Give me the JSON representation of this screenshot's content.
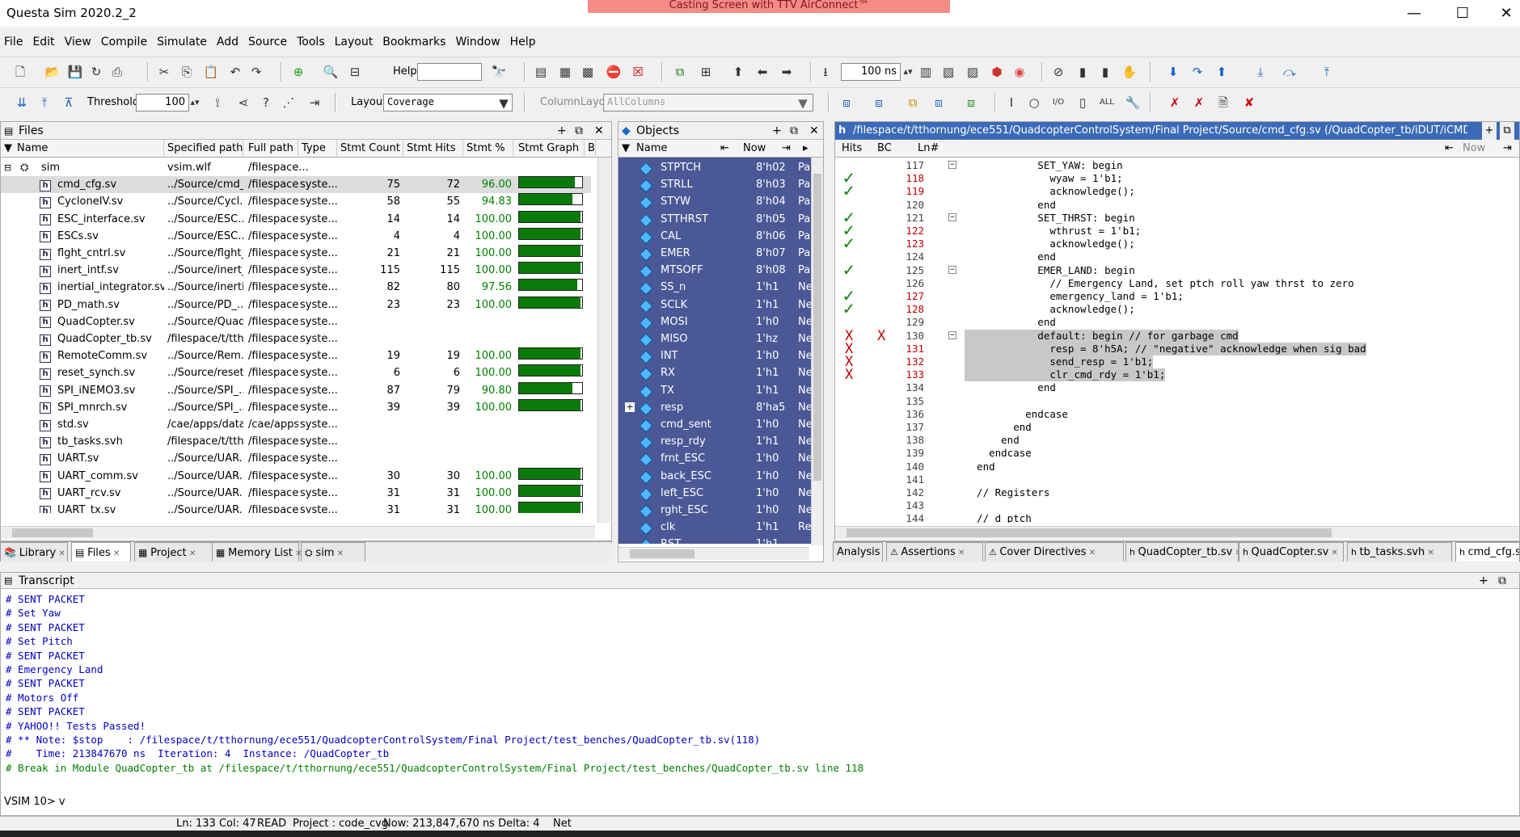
{
  "window": {
    "title": "Questa Sim 2020.2_2",
    "banner": "Casting Screen with TTV AirConnect™"
  },
  "menu": [
    "File",
    "Edit",
    "View",
    "Compile",
    "Simulate",
    "Add",
    "Source",
    "Tools",
    "Layout",
    "Bookmarks",
    "Window",
    "Help"
  ],
  "toolbar": {
    "help_label": "Help",
    "time_value": "100 ns",
    "threshold_label": "Threshold",
    "threshold_value": "100",
    "layout_label": "Layout",
    "layout_value": "Coverage",
    "columnlayout_label": "ColumnLayout",
    "columnlayout_value": "AllColumns"
  },
  "files_pane": {
    "title": "Files",
    "columns": [
      "Name",
      "Specified path",
      "Full path",
      "Type",
      "Stmt Count",
      "Stmt Hits",
      "Stmt %",
      "Stmt Graph",
      "B"
    ],
    "root": {
      "name": "sim",
      "spec": "vsim.wlf",
      "full": "/filespace..."
    },
    "rows": [
      {
        "name": "cmd_cfg.sv",
        "spec": "../Source/cmd_...",
        "full": "/filespace...",
        "type": "syste...",
        "count": "75",
        "hits": "72",
        "pct": "96.00",
        "fill": 0.96
      },
      {
        "name": "CycloneIV.sv",
        "spec": "../Source/Cycl...",
        "full": "/filespace...",
        "type": "syste...",
        "count": "58",
        "hits": "55",
        "pct": "94.83",
        "fill": 0.9483
      },
      {
        "name": "ESC_interface.sv",
        "spec": "../Source/ESC...",
        "full": "/filespace...",
        "type": "syste...",
        "count": "14",
        "hits": "14",
        "pct": "100.00",
        "fill": 1
      },
      {
        "name": "ESCs.sv",
        "spec": "../Source/ESC...",
        "full": "/filespace...",
        "type": "syste...",
        "count": "4",
        "hits": "4",
        "pct": "100.00",
        "fill": 1
      },
      {
        "name": "flght_cntrl.sv",
        "spec": "../Source/flght_...",
        "full": "/filespace...",
        "type": "syste...",
        "count": "21",
        "hits": "21",
        "pct": "100.00",
        "fill": 1
      },
      {
        "name": "inert_intf.sv",
        "spec": "../Source/inert_...",
        "full": "/filespace...",
        "type": "syste...",
        "count": "115",
        "hits": "115",
        "pct": "100.00",
        "fill": 1
      },
      {
        "name": "inertial_integrator.sv",
        "spec": "../Source/inerti...",
        "full": "/filespace...",
        "type": "syste...",
        "count": "82",
        "hits": "80",
        "pct": "97.56",
        "fill": 0.9756
      },
      {
        "name": "PD_math.sv",
        "spec": "../Source/PD_...",
        "full": "/filespace...",
        "type": "syste...",
        "count": "23",
        "hits": "23",
        "pct": "100.00",
        "fill": 1
      },
      {
        "name": "QuadCopter.sv",
        "spec": "../Source/Quad...",
        "full": "/filespace...",
        "type": "syste...",
        "count": "",
        "hits": "",
        "pct": "",
        "fill": null
      },
      {
        "name": "QuadCopter_tb.sv",
        "spec": "/filespace/t/ttho...",
        "full": "/filespace...",
        "type": "syste...",
        "count": "",
        "hits": "",
        "pct": "",
        "fill": null
      },
      {
        "name": "RemoteComm.sv",
        "spec": "../Source/Rem...",
        "full": "/filespace...",
        "type": "syste...",
        "count": "19",
        "hits": "19",
        "pct": "100.00",
        "fill": 1
      },
      {
        "name": "reset_synch.sv",
        "spec": "../Source/reset...",
        "full": "/filespace...",
        "type": "syste...",
        "count": "6",
        "hits": "6",
        "pct": "100.00",
        "fill": 1
      },
      {
        "name": "SPI_iNEMO3.sv",
        "spec": "../Source/SPI_...",
        "full": "/filespace...",
        "type": "syste...",
        "count": "87",
        "hits": "79",
        "pct": "90.80",
        "fill": 0.908
      },
      {
        "name": "SPI_mnrch.sv",
        "spec": "../Source/SPI_...",
        "full": "/filespace...",
        "type": "syste...",
        "count": "39",
        "hits": "39",
        "pct": "100.00",
        "fill": 1
      },
      {
        "name": "std.sv",
        "spec": "/cae/apps/data/...",
        "full": "/cae/apps...",
        "type": "syste...",
        "count": "",
        "hits": "",
        "pct": "",
        "fill": null
      },
      {
        "name": "tb_tasks.svh",
        "spec": "/filespace/t/ttho...",
        "full": "/filespace...",
        "type": "syste...",
        "count": "",
        "hits": "",
        "pct": "",
        "fill": null
      },
      {
        "name": "UART.sv",
        "spec": "../Source/UAR...",
        "full": "/filespace...",
        "type": "syste...",
        "count": "",
        "hits": "",
        "pct": "",
        "fill": null
      },
      {
        "name": "UART_comm.sv",
        "spec": "../Source/UAR...",
        "full": "/filespace...",
        "type": "syste...",
        "count": "30",
        "hits": "30",
        "pct": "100.00",
        "fill": 1
      },
      {
        "name": "UART_rcv.sv",
        "spec": "../Source/UAR...",
        "full": "/filespace...",
        "type": "syste...",
        "count": "31",
        "hits": "31",
        "pct": "100.00",
        "fill": 1
      },
      {
        "name": "UART_tx.sv",
        "spec": "../Source/UAR...",
        "full": "/filespace...",
        "type": "syste...",
        "count": "31",
        "hits": "31",
        "pct": "100.00",
        "fill": 1
      }
    ]
  },
  "left_tabs": [
    "Library",
    "Files",
    "Project",
    "Memory List",
    "sim"
  ],
  "objects_pane": {
    "title": "Objects",
    "name_col": "Name",
    "now_label": "Now",
    "rows": [
      {
        "name": "STPTCH",
        "value": "8'h02",
        "kind": "Pa"
      },
      {
        "name": "STRLL",
        "value": "8'h03",
        "kind": "Pa"
      },
      {
        "name": "STYW",
        "value": "8'h04",
        "kind": "Pa"
      },
      {
        "name": "STTHRST",
        "value": "8'h05",
        "kind": "Pa"
      },
      {
        "name": "CAL",
        "value": "8'h06",
        "kind": "Pa"
      },
      {
        "name": "EMER",
        "value": "8'h07",
        "kind": "Pa"
      },
      {
        "name": "MTSOFF",
        "value": "8'h08",
        "kind": "Pa"
      },
      {
        "name": "SS_n",
        "value": "1'h1",
        "kind": "Ne"
      },
      {
        "name": "SCLK",
        "value": "1'h1",
        "kind": "Ne"
      },
      {
        "name": "MOSI",
        "value": "1'h0",
        "kind": "Ne"
      },
      {
        "name": "MISO",
        "value": "1'hz",
        "kind": "Ne"
      },
      {
        "name": "INT",
        "value": "1'h0",
        "kind": "Ne"
      },
      {
        "name": "RX",
        "value": "1'h1",
        "kind": "Ne"
      },
      {
        "name": "TX",
        "value": "1'h1",
        "kind": "Ne"
      },
      {
        "name": "resp",
        "value": "8'ha5",
        "kind": "Ne"
      },
      {
        "name": "cmd_sent",
        "value": "1'h0",
        "kind": "Ne"
      },
      {
        "name": "resp_rdy",
        "value": "1'h1",
        "kind": "Ne"
      },
      {
        "name": "frnt_ESC",
        "value": "1'h0",
        "kind": "Ne"
      },
      {
        "name": "back_ESC",
        "value": "1'h0",
        "kind": "Ne"
      },
      {
        "name": "left_ESC",
        "value": "1'h0",
        "kind": "Ne"
      },
      {
        "name": "rght_ESC",
        "value": "1'h0",
        "kind": "Ne"
      },
      {
        "name": "clk",
        "value": "1'h1",
        "kind": "Re"
      },
      {
        "name": "RST_",
        "value": "1'h1",
        "kind": ""
      }
    ]
  },
  "source_pane": {
    "title": "/filespace/t/tthornung/ece551/QuadcopterControlSystem/Final Project/Source/cmd_cfg.sv (/QuadCopter_tb/iDUT/iCMD) - by file - Default",
    "cols": [
      "Hits",
      "BC",
      "Ln#"
    ],
    "now_label": "Now",
    "lines": [
      {
        "n": "117",
        "red": false,
        "hit": "",
        "code": "            SET_YAW: begin"
      },
      {
        "n": "118",
        "red": true,
        "hit": "check",
        "code": "              wyaw = 1'b1;"
      },
      {
        "n": "119",
        "red": true,
        "hit": "check",
        "code": "              acknowledge();"
      },
      {
        "n": "120",
        "red": false,
        "hit": "",
        "code": "            end"
      },
      {
        "n": "121",
        "red": false,
        "hit": "check",
        "code": "            SET_THRST: begin"
      },
      {
        "n": "122",
        "red": true,
        "hit": "check",
        "code": "              wthrust = 1'b1;"
      },
      {
        "n": "123",
        "red": true,
        "hit": "check",
        "code": "              acknowledge();"
      },
      {
        "n": "124",
        "red": false,
        "hit": "",
        "code": "            end"
      },
      {
        "n": "125",
        "red": false,
        "hit": "check",
        "code": "            EMER_LAND: begin"
      },
      {
        "n": "126",
        "red": false,
        "hit": "",
        "code": "              // Emergency Land, set ptch roll yaw thrst to zero"
      },
      {
        "n": "127",
        "red": true,
        "hit": "check",
        "code": "              emergency_land = 1'b1;"
      },
      {
        "n": "128",
        "red": true,
        "hit": "check",
        "code": "              acknowledge();"
      },
      {
        "n": "129",
        "red": false,
        "hit": "",
        "code": "            end"
      },
      {
        "n": "130",
        "red": false,
        "hit": "XB",
        "code": "            default: begin // for garbage cmd"
      },
      {
        "n": "131",
        "red": true,
        "hit": "XS",
        "code": "              resp = 8'h5A; // \"negative\" acknowledge when sig bad"
      },
      {
        "n": "132",
        "red": true,
        "hit": "XS",
        "code": "              send_resp = 1'b1;"
      },
      {
        "n": "133",
        "red": true,
        "hit": "XS",
        "code": "              clr_cmd_rdy = 1'b1;"
      },
      {
        "n": "134",
        "red": false,
        "hit": "",
        "code": "            end"
      },
      {
        "n": "135",
        "red": false,
        "hit": "",
        "code": ""
      },
      {
        "n": "136",
        "red": false,
        "hit": "",
        "code": "          endcase"
      },
      {
        "n": "137",
        "red": false,
        "hit": "",
        "code": "        end"
      },
      {
        "n": "138",
        "red": false,
        "hit": "",
        "code": "      end"
      },
      {
        "n": "139",
        "red": false,
        "hit": "",
        "code": "    endcase"
      },
      {
        "n": "140",
        "red": false,
        "hit": "",
        "code": "  end"
      },
      {
        "n": "141",
        "red": false,
        "hit": "",
        "code": ""
      },
      {
        "n": "142",
        "red": false,
        "hit": "",
        "code": "  // Registers"
      },
      {
        "n": "143",
        "red": false,
        "hit": "",
        "code": ""
      },
      {
        "n": "144",
        "red": false,
        "hit": "",
        "code": "  // d_ptch"
      }
    ]
  },
  "right_tabs": [
    "Analysis",
    "Assertions",
    "Cover Directives",
    "QuadCopter_tb.sv",
    "QuadCopter.sv",
    "tb_tasks.svh",
    "cmd_cfg.sv"
  ],
  "transcript": {
    "title": "Transcript",
    "lines": [
      {
        "t": "# SENT PACKET",
        "g": false
      },
      {
        "t": "# Set Yaw",
        "g": false
      },
      {
        "t": "# SENT PACKET",
        "g": false
      },
      {
        "t": "# Set Pitch",
        "g": false
      },
      {
        "t": "# SENT PACKET",
        "g": false
      },
      {
        "t": "# Emergency Land",
        "g": false
      },
      {
        "t": "# SENT PACKET",
        "g": false
      },
      {
        "t": "# Motors Off",
        "g": false
      },
      {
        "t": "# SENT PACKET",
        "g": false
      },
      {
        "t": "# YAHOO!! Tests Passed!",
        "g": false
      },
      {
        "t": "# ** Note: $stop    : /filespace/t/tthornung/ece551/QuadcopterControlSystem/Final Project/test_benches/QuadCopter_tb.sv(118)",
        "g": false
      },
      {
        "t": "#    Time: 213847670 ns  Iteration: 4  Instance: /QuadCopter_tb",
        "g": false
      },
      {
        "t": "# Break in Module QuadCopter_tb at /filespace/t/tthornung/ece551/QuadcopterControlSystem/Final Project/test_benches/QuadCopter_tb.sv line 118",
        "g": true
      }
    ],
    "prompt": "VSIM 10> v"
  },
  "status": {
    "ln": "Ln:  133  Col: 47",
    "mode": "READ",
    "project": "Project : code_cvg",
    "now": "Now: 213,847,670 ns   Delta: 4",
    "net": "Net"
  }
}
